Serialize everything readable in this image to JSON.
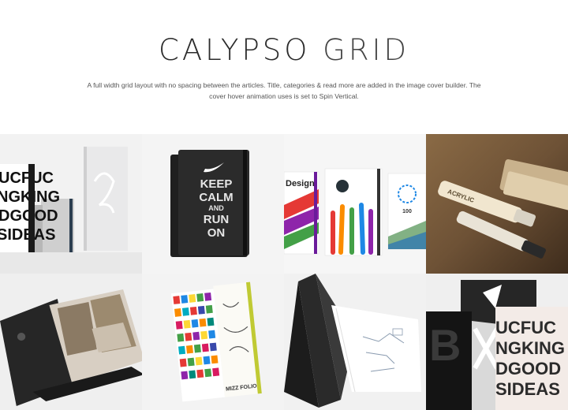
{
  "header": {
    "title_main": "CALYPSO",
    "title_sub": "GRID",
    "description": "A full width grid layout with no spacing between the articles. Title, categories & read more are added in the image cover builder. The cover hover  animation uses is set to Spin Vertical."
  },
  "grid": {
    "tiles": [
      {
        "name": "tile-notebooks-white"
      },
      {
        "name": "tile-keep-calm-notebook"
      },
      {
        "name": "tile-design-notebooks"
      },
      {
        "name": "tile-acrylic-markers"
      },
      {
        "name": "tile-open-book"
      },
      {
        "name": "tile-folio-notebook"
      },
      {
        "name": "tile-folded-notebook"
      },
      {
        "name": "tile-black-notebooks"
      }
    ],
    "keep_calm": {
      "line1": "KEEP",
      "line2": "CALM",
      "line3": "AND",
      "line4": "RUN",
      "line5": "ON"
    },
    "design_label": "Design",
    "acrylic_label": "ACRYLIC",
    "folio_label": "MIZZ FOLIO",
    "typo_lines": [
      "UCFUC",
      "NGKING",
      "DGOOD",
      "SIDEAS"
    ],
    "big_letter": "B",
    "badge_number": "100"
  },
  "colors": {
    "background": "#ffffff",
    "title": "#2b2b2b",
    "text": "#555555"
  }
}
